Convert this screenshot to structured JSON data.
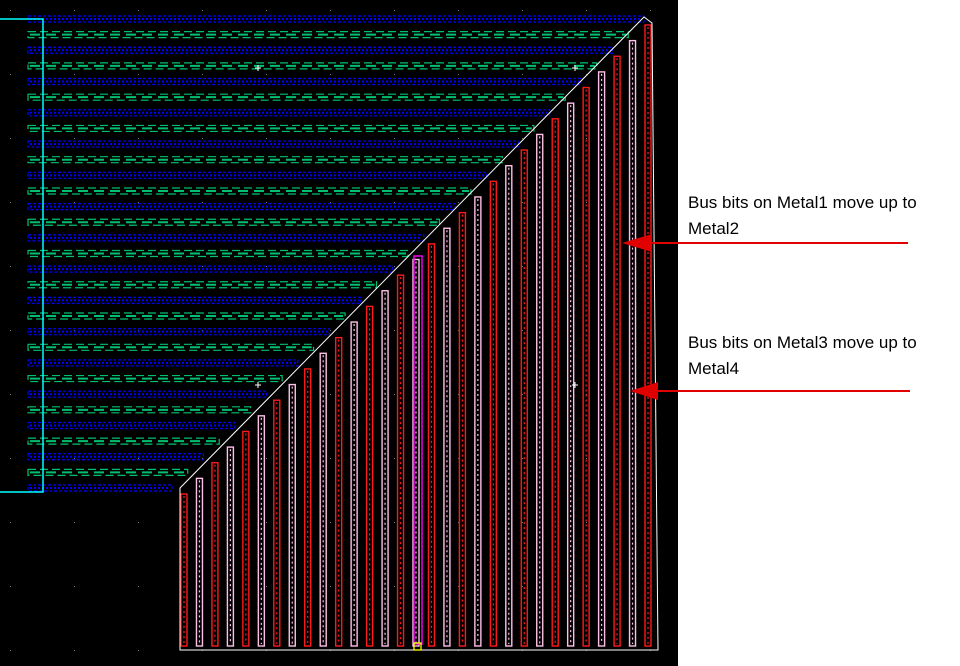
{
  "view": {
    "background": "#000000",
    "page_background": "#ffffff"
  },
  "layers": {
    "metal1": {
      "name": "Metal1",
      "color": "#0000ff"
    },
    "metal2": {
      "name": "Metal2",
      "color": "#ff1a1a"
    },
    "metal3": {
      "name": "Metal3",
      "color": "#00c070"
    },
    "metal4": {
      "name": "Metal4",
      "color": "#ffc0e8"
    },
    "boundary": {
      "color": "#ffffff"
    },
    "cell_outline": {
      "color": "#00ffff"
    },
    "highlight": {
      "color": "#ff00ff"
    },
    "marker": {
      "color": "#ffff00"
    }
  },
  "bus": {
    "horizontal_track_count": 31,
    "vertical_track_count": 31
  },
  "annotations": [
    {
      "id": "metal1-to-metal2",
      "text": "Bus bits on Metal1 move up to Metal2",
      "arrow_color": "#e00000"
    },
    {
      "id": "metal3-to-metal4",
      "text": "Bus bits on Metal3 move up to Metal4",
      "arrow_color": "#e00000"
    }
  ]
}
